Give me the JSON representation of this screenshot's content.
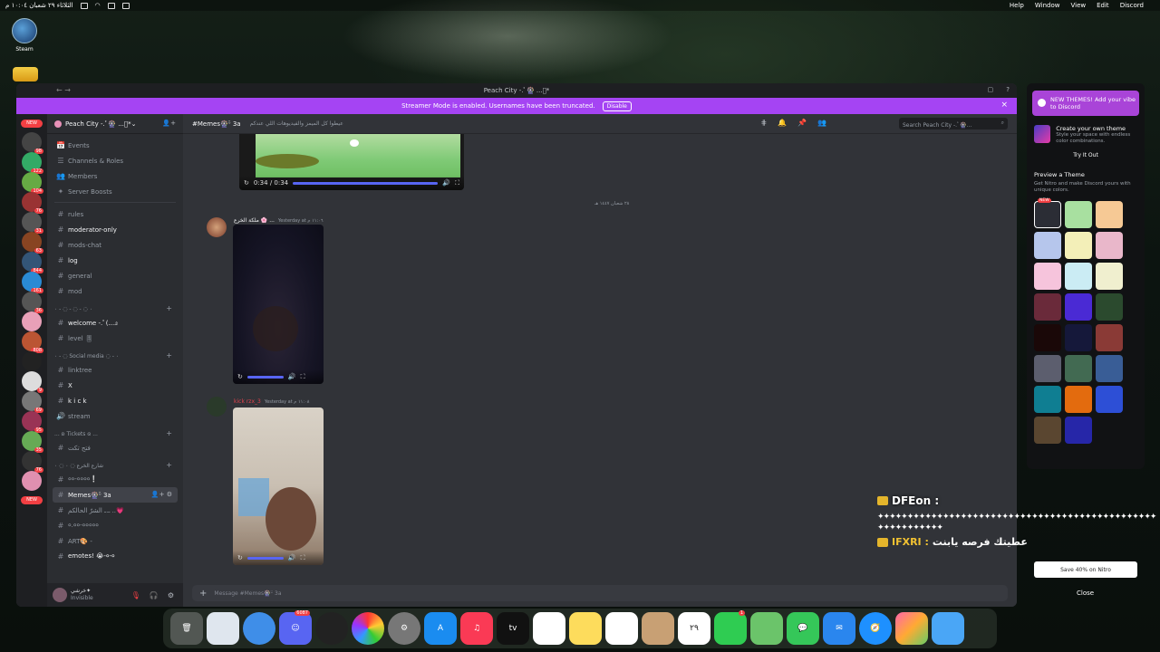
{
  "menubar": {
    "status_text": "الثلاثاء ٢٩ شعبان ١٠:٠٤ م",
    "menus": [
      "Help",
      "Window",
      "View",
      "Edit",
      "Discord"
    ]
  },
  "desktop": {
    "steam_label": "Steam"
  },
  "window": {
    "title": "Peach City -.ﾟ🎡 ...ﾟ*"
  },
  "streamer_banner": {
    "text": "Streamer Mode is enabled. Usernames have been truncated.",
    "disable_label": "Disable"
  },
  "guild": {
    "name": "Peach City -.ﾟ🎡 ...ﾟ*",
    "top_items": [
      {
        "icon": "📅",
        "label": "Events"
      },
      {
        "icon": "☰",
        "label": "Channels & Roles"
      },
      {
        "icon": "👥",
        "label": "Members"
      },
      {
        "icon": "✦",
        "label": "Server Boosts"
      }
    ],
    "channels_a": [
      {
        "icon": "#",
        "label": "rules",
        "unread": false
      },
      {
        "icon": "#",
        "label": "moderator-only",
        "unread": true
      },
      {
        "icon": "#",
        "label": "mods-chat",
        "unread": false
      },
      {
        "icon": "#",
        "label": "log",
        "unread": true
      },
      {
        "icon": "#",
        "label": "general",
        "unread": false
      },
      {
        "icon": "#",
        "label": "mod",
        "unread": false
      }
    ],
    "category_b": "۰ - ◌ - ◌ - ◌ ۰",
    "channels_b": [
      {
        "icon": "#",
        "label": "welcome -.ﾟ(...೨",
        "unread": true
      },
      {
        "icon": "#",
        "label": "level 🎚",
        "unread": false
      }
    ],
    "category_c": "۰ - ◌ Social media ◌ - ۰",
    "channels_c": [
      {
        "icon": "#",
        "label": "linktree",
        "unread": false
      },
      {
        "icon": "#",
        "label": "X",
        "unread": true
      },
      {
        "icon": "#",
        "label": "k i c k",
        "unread": true
      },
      {
        "icon": "🔊",
        "label": "stream",
        "unread": false
      }
    ],
    "category_d": "... ʚ Tickets ɞ ...",
    "channels_d": [
      {
        "icon": "#",
        "label": "فتح تكت",
        "unread": false
      }
    ],
    "category_e": "۰ ◌ شارع الخرع ◌ ۰",
    "channels_e": [
      {
        "icon": "#",
        "label": "००-००००❕",
        "unread": false
      },
      {
        "icon": "#",
        "label": "Memes🎡ᵕ̈ 3a",
        "unread": true,
        "active": true
      },
      {
        "icon": "#",
        "label": "ـ.ـ الشرّ الحالكم ..💗",
        "unread": false
      },
      {
        "icon": "#",
        "label": "०.००-०००००",
        "unread": false
      },
      {
        "icon": "#",
        "label": "ART🎨 -",
        "unread": false
      },
      {
        "icon": "#",
        "label": "emotes! 😭-०-०",
        "unread": true
      }
    ],
    "user": {
      "name": "خرشي✦",
      "status": "Invisible"
    }
  },
  "chat": {
    "channel_name": "Memes🎡ᵕ̈ 3a",
    "topic": "عيطوا كل الميمز والفيديوهات اللي عندكم",
    "search_placeholder": "Search Peach City -.ﾟ🎡...",
    "video1_time": "0:34 / 0:34",
    "divider_text": "٢٨ شعبان ١٤٤٧ هـ",
    "msg1_author": "ملكة الخرع 🌸 ...",
    "msg1_time": "Yesterday at ١١:٠٦ م",
    "msg2_author": "kick rzx_3",
    "msg2_time": "Yesterday at ١١:٠٨ م",
    "composer_placeholder": "Message #Memes🎡ᵕ̈ 3a"
  },
  "theme_panel": {
    "new_title": "NEW THEMES! Add your vibe to Discord",
    "create_title": "Create your own theme",
    "create_sub": "Style your space with endless color combinations.",
    "try_label": "Try It Out",
    "preview_title": "Preview a Theme",
    "preview_sub": "Get Nitro and make Discord yours with unique colors.",
    "new_badge": "NEW",
    "swatch_colors": [
      "#2b2d35",
      "#a8e0a0",
      "#f6c995",
      "#b6c6ec",
      "#f3efb8",
      "#e9b7ca",
      "#f6c4dc",
      "#cbecf4",
      "#f0efcf",
      "#6a2a3a",
      "#4a2ad4",
      "#2b4a2e",
      "#1a0808",
      "#15183a",
      "#8a3a36",
      "#5c5e6e",
      "#426a52",
      "#395d96",
      "#0f7e92",
      "#e36b0e",
      "#2d4fd6",
      "#5a4630",
      "#2626a8"
    ]
  },
  "stream_overlay": {
    "user1": "DFEon :",
    "user1_text": "✦✦✦✦✦✦✦✦✦✦✦✦✦✦✦✦✦✦✦✦✦✦✦✦✦✦✦✦✦✦✦✦✦✦✦✦✦✦✦✦✦✦✦✦✦✦✦✦✦✦✦✦✦✦✦✦✦✦✦✦✦✦✦✦✦✦✦✦✦✦✦✦✦✦✦✦✦✦✦✦✦✦✦✦✦✦✦✦✦✦✦✦✦✦✦✦✦✦✦✦✦✦✦✦✦✦✦✦✦✦✦✦✦✦✦✦✦✦✦✦✦✦✦✦",
    "user1_tail": "✦✦✦✦✦✦✦✦✦✦✦",
    "user2": "IFXRI :",
    "user2_text": "عطيتك فرصه يابنت"
  },
  "nitro_toast": {
    "text": "Save 40% on Nitro",
    "close_label": "Close"
  },
  "dock": {
    "badges": {
      "discord": "6087",
      "music_cal": "٢٩",
      "facetime": "1"
    },
    "apps": [
      "Trash",
      "Files",
      "Finder",
      "Discord",
      "Screen",
      "Photos",
      "Settings",
      "App Store",
      "Music",
      "TV",
      "Freeform",
      "Notes",
      "Reminders",
      "Contacts",
      "Calendar",
      "FaceTime",
      "Maps",
      "Messages",
      "Mail",
      "Safari",
      "Launchpad",
      "Finder2"
    ]
  }
}
